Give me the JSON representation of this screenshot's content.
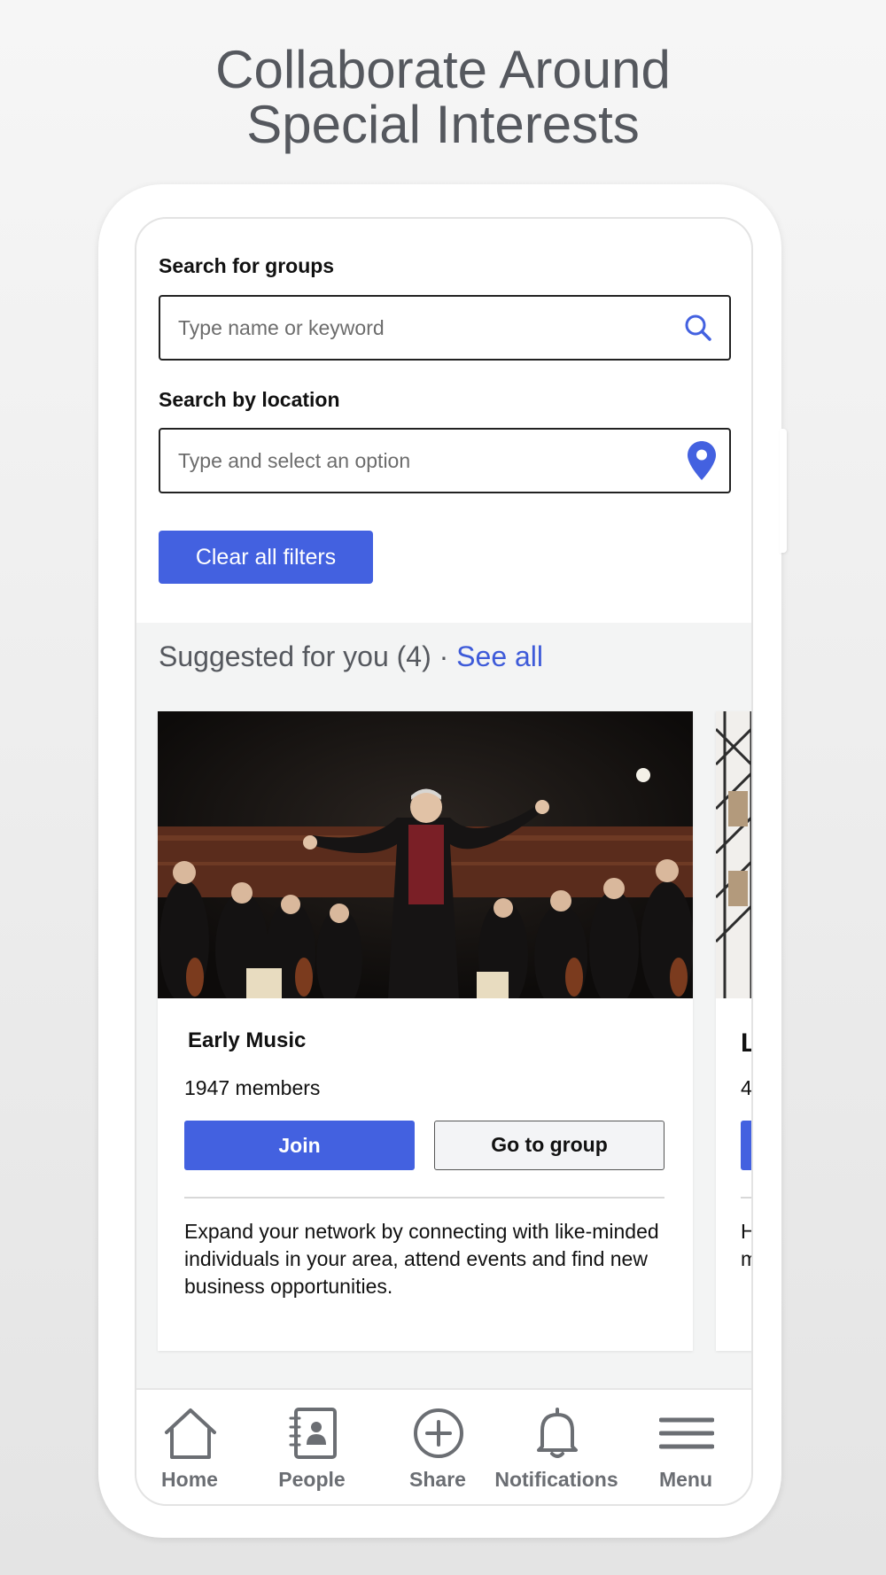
{
  "headline": {
    "line1": "Collaborate Around",
    "line2": "Special Interests"
  },
  "filters": {
    "group_label": "Search for groups",
    "group_placeholder": "Type name or keyword",
    "location_label": "Search by location",
    "location_placeholder": "Type and select an option",
    "clear_label": "Clear all filters"
  },
  "suggested": {
    "title": "Suggested for you (4) · ",
    "see_all": "See all"
  },
  "cards": [
    {
      "title": "Early Music",
      "members": "1947 members",
      "join_label": "Join",
      "goto_label": "Go to group",
      "description": "Expand your network by connecting with like-minded individuals in your area, attend events and find new business opportunities."
    },
    {
      "title": "L",
      "members": "4",
      "description": "H m"
    }
  ],
  "nav": {
    "items": [
      {
        "label": "Home",
        "icon": "home-icon"
      },
      {
        "label": "People",
        "icon": "contacts-book-icon"
      },
      {
        "label": "Share",
        "icon": "plus-circle-icon"
      },
      {
        "label": "Notifications",
        "icon": "bell-icon"
      },
      {
        "label": "Menu",
        "icon": "hamburger-icon"
      }
    ]
  },
  "colors": {
    "accent": "#4361e0",
    "link": "#3e5bd9",
    "nav_gray": "#6b6e73",
    "headline_gray": "#55585e"
  }
}
